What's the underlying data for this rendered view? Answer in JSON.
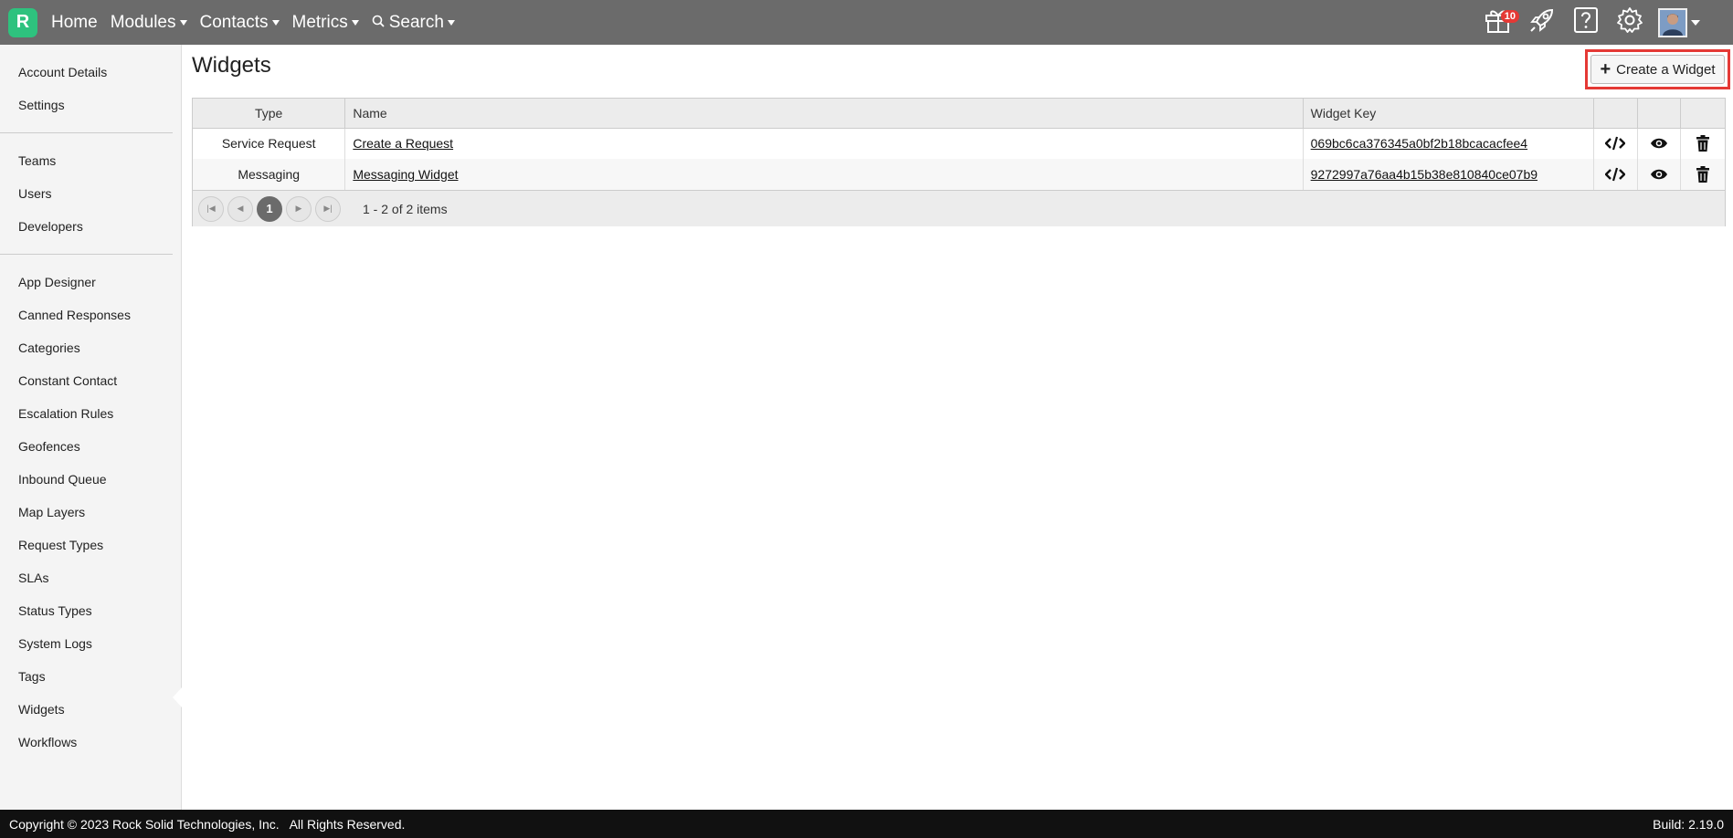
{
  "nav": {
    "logo": "R",
    "home": "Home",
    "modules": "Modules",
    "contacts": "Contacts",
    "metrics": "Metrics",
    "search": "Search",
    "notification_count": "10",
    "icons": [
      "gift-icon",
      "rocket-icon",
      "help-icon",
      "gear-icon",
      "avatar"
    ]
  },
  "sidebar": {
    "groups": [
      [
        "Account Details",
        "Settings"
      ],
      [
        "Teams",
        "Users",
        "Developers"
      ],
      [
        "App Designer",
        "Canned Responses",
        "Categories",
        "Constant Contact",
        "Escalation Rules",
        "Geofences",
        "Inbound Queue",
        "Map Layers",
        "Request Types",
        "SLAs",
        "Status Types",
        "System Logs",
        "Tags",
        "Widgets",
        "Workflows"
      ]
    ],
    "active": "Widgets"
  },
  "page": {
    "title": "Widgets",
    "create_button": "Create a Widget"
  },
  "table": {
    "columns": [
      "Type",
      "Name",
      "Widget Key"
    ],
    "rows": [
      {
        "type": "Service Request",
        "name": "Create a Request",
        "key": "069bc6ca376345a0bf2b18bcacacfee4"
      },
      {
        "type": "Messaging",
        "name": "Messaging Widget",
        "key": "9272997a76aa4b15b38e810840ce07b9"
      }
    ],
    "pager": {
      "current_page": "1",
      "info": "1 - 2 of 2 items"
    }
  },
  "footer": {
    "copyright": "Copyright © 2023 Rock Solid Technologies, Inc.   All Rights Reserved.",
    "build": "Build: 2.19.0"
  },
  "colors": {
    "topbar": "#6b6b6b",
    "logo": "#2ec27e",
    "highlight": "#e53935",
    "footer": "#111111"
  }
}
